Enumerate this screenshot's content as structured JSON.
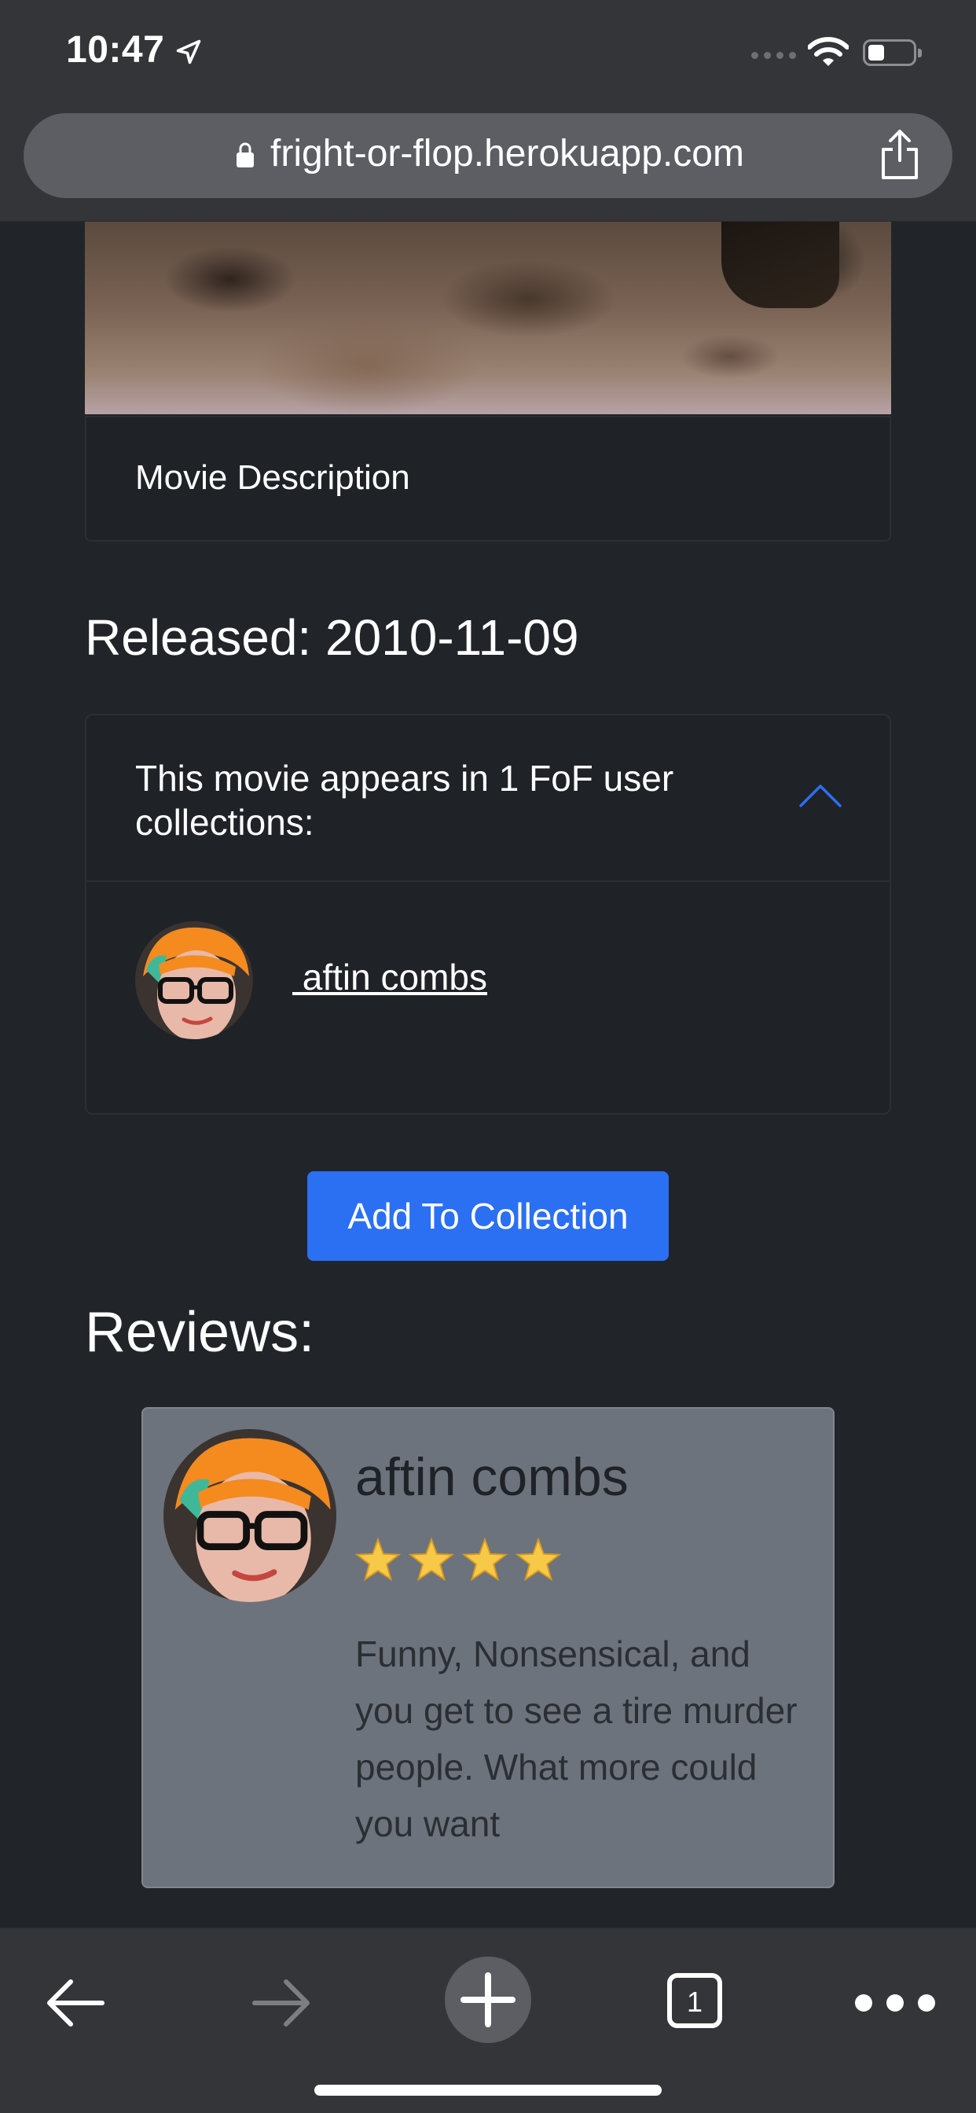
{
  "status_bar": {
    "time": "10:47"
  },
  "browser": {
    "url": "fright-or-flop.herokuapp.com"
  },
  "movie": {
    "description_label": "Movie Description",
    "released": "Released: 2010-11-09"
  },
  "collections": {
    "header": "This movie appears in 1 FoF user collections:",
    "users": [
      {
        "name": " aftin combs"
      }
    ]
  },
  "actions": {
    "add_to_collection": "Add To Collection"
  },
  "reviews": {
    "heading": "Reviews:",
    "items": [
      {
        "author": "aftin combs",
        "rating": 4,
        "rating_max": 4,
        "text": "Funny, Nonsensical, and you get to see a tire murder people. What more could you want"
      }
    ]
  },
  "toolbar": {
    "tab_count": "1"
  },
  "colors": {
    "background": "#212529",
    "accent_blue": "#2b6ff3",
    "review_card": "#6c737c",
    "chrome": "#343538"
  },
  "icons": [
    "location-arrow-icon",
    "wifi-icon",
    "battery-icon",
    "lock-icon",
    "share-icon",
    "chevron-up-icon",
    "star-icon",
    "back-icon",
    "forward-icon",
    "new-tab-icon",
    "tabs-icon",
    "more-icon"
  ]
}
